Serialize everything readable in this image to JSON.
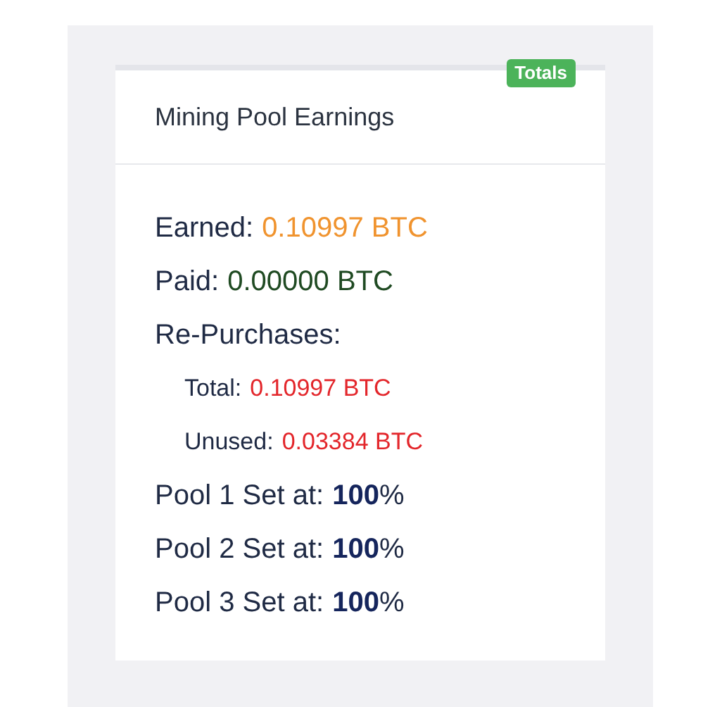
{
  "card": {
    "badge": "Totals",
    "title": "Mining Pool Earnings"
  },
  "lines": [
    {
      "kind": "main",
      "label": "Earned:",
      "value": "0.10997 BTC",
      "color": "#f0932e"
    },
    {
      "kind": "main",
      "label": "Paid:",
      "value": "0.00000 BTC",
      "color": "#1f4a22"
    },
    {
      "kind": "heading",
      "label": "Re-Purchases:"
    },
    {
      "kind": "sub",
      "label": "Total:",
      "value": "0.10997 BTC",
      "color": "#e3262b"
    },
    {
      "kind": "sub",
      "label": "Unused:",
      "value": "0.03384 BTC",
      "color": "#e3262b"
    },
    {
      "kind": "percent",
      "label": "Pool 1 Set at:",
      "value": "100",
      "unit": "%"
    },
    {
      "kind": "percent",
      "label": "Pool 2 Set at:",
      "value": "100",
      "unit": "%"
    },
    {
      "kind": "percent",
      "label": "Pool 3 Set at:",
      "value": "100",
      "unit": "%"
    }
  ]
}
